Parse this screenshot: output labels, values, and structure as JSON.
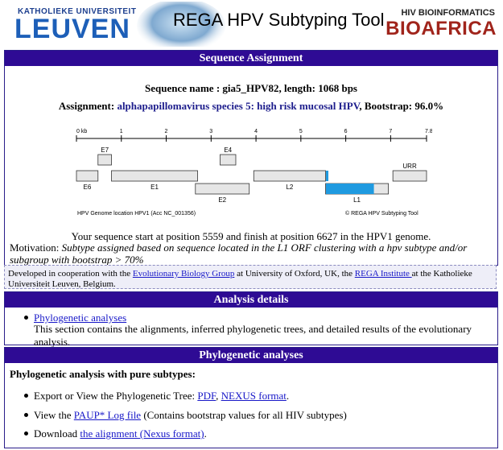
{
  "header": {
    "kul_small": "KATHOLIEKE UNIVERSITEIT",
    "kul_big": "LEUVEN",
    "app_title": "REGA HPV Subtyping Tool",
    "hiv_small": "HIV BIOINFORMATICS",
    "hiv_big": "BIOAFRICA"
  },
  "sequence_assignment": {
    "title": "Sequence Assignment",
    "sequence_name": "Sequence name : gia5_HPV82, length: 1068 bps",
    "assignment_label": "Assignment: ",
    "assignment_value": "alphapapillomavirus species 5: high risk mucosal HPV",
    "bootstrap": ", Bootstrap: 96.0%",
    "position_text": "Your sequence start at position 5559 and finish at position 6627 in the HPV1 genome.",
    "motivation_label": "Motivation: ",
    "motivation_text": "Subtype assigned based on sequence located in the L1 ORF clustering with a hpv subtype and/or subgroup with bootstrap > 70%"
  },
  "genome_map": {
    "ticks": [
      "0 kb",
      "1",
      "2",
      "3",
      "4",
      "5",
      "6",
      "7",
      "7.8"
    ],
    "genes": [
      "E7",
      "E4",
      "URR",
      "E6",
      "E1",
      "L2",
      "E2",
      "L1"
    ],
    "footer_left": "HPV Genome location HPV1 (Acc NC_001356)",
    "footer_right": "© REGA HPV Subtyping Tool",
    "query_start_kb": 5.559,
    "query_end_kb": 6.627,
    "colors": {
      "query": "#1f9ae0",
      "gene": "#e6e6e6",
      "gene_border": "#333333"
    }
  },
  "cooperation": {
    "text1": "Developed in cooperation with the ",
    "link1": "Evolutionary Biology Group",
    "text2": " at University of Oxford, UK, the ",
    "link2": "REGA Institute ",
    "text3": "at the Katholieke Universiteit Leuven, Belgium."
  },
  "analysis_details": {
    "title": "Analysis details",
    "link": "Phylogenetic analyses",
    "description": "This section contains the alignments, inferred phylogenetic trees, and detailed results of the evolutionary analysis."
  },
  "phylogenetic": {
    "title": "Phylogenetic analyses",
    "subtitle": "Phylogenetic analysis with pure subtypes:",
    "item1_text": "Export or View the Phylogenetic Tree: ",
    "item1_link1": "PDF",
    "item1_sep": ", ",
    "item1_link2": "NEXUS format",
    "item1_end": ".",
    "item2_text": "View the ",
    "item2_link": "PAUP* Log file",
    "item2_end": " (Contains bootstrap values for all HIV subtypes)",
    "item3_text": "Download ",
    "item3_link": "the alignment (Nexus format)",
    "item3_end": "."
  }
}
